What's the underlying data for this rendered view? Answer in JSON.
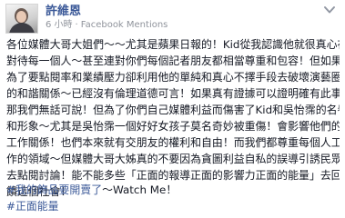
{
  "post": {
    "author": "許維恩",
    "time": "6 小時",
    "sep": "·",
    "app": "Facebook Mentions",
    "body_lines": [
      "各位媒體大哥大姐們～～尤其是蘋果日報的！Kid從我認識他就很真心在",
      "對待每一個人～甚至連對你們每個記者朋友都相當尊重和包容！但如果",
      "為了要點閱率和業績壓力卻利用他的單純和真心不擇手段去破壞演藝圈",
      "的和諧關係～已經沒有倫理道德可言！如果真有證據可以證明確有此事",
      "那我們無話可說！但為了你們自己媒體利益而傷害了Kid和吳怡霈的名譽",
      "和形象～尤其是吳怡霈一個好好女孩子莫名奇妙被重傷！會影響他們的",
      "工作關係！也們本來就有交朋友的權利和自由！而我們都尊重每個人工",
      "作的領域～但媒體大哥大姊真的不要因為貪圖利益自私的誤導引誘民眾",
      "去點閱討論！能不能多些「正面的報導正面的影響力正面的能量」去回",
      "饋這個社會！"
    ],
    "tag_line_1_hashtag": "#我的飾品要開賣了",
    "tag_line_1_suffix": "～Watch Me！",
    "tag_line_2_hashtag": "#正面能量"
  },
  "icons": {
    "menu": "chevron-down-icon",
    "time": "clock-icon"
  },
  "colors": {
    "link": "#3b5998",
    "meta": "#90949c",
    "text": "#141823"
  }
}
